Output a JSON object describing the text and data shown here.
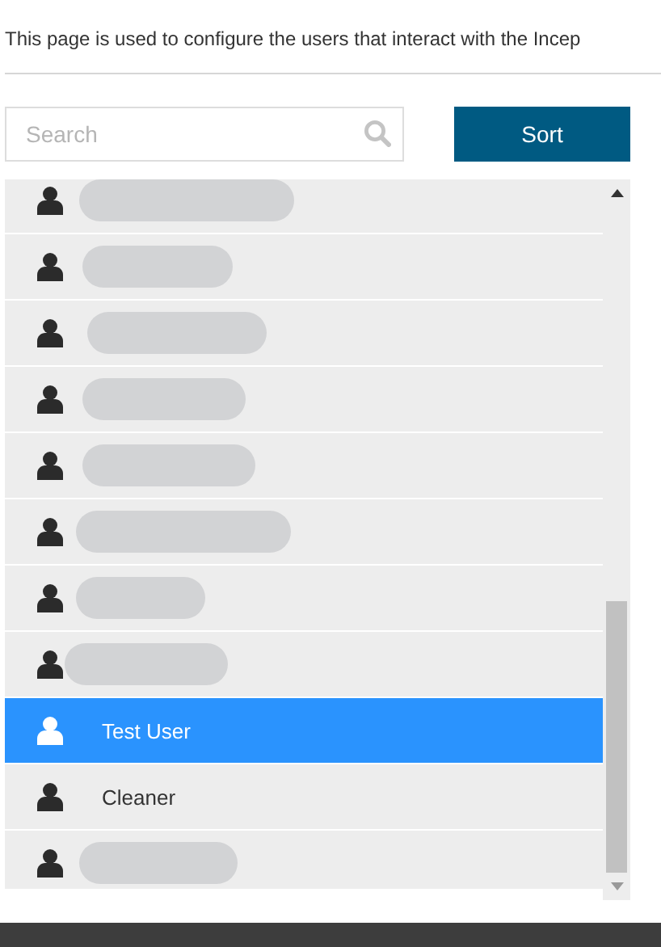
{
  "intro": "This page is used to configure the users that interact with the Incep",
  "search": {
    "placeholder": "Search"
  },
  "sort_button": "Sort",
  "users": [
    {
      "kind": "redacted",
      "selected": false
    },
    {
      "kind": "redacted",
      "selected": false
    },
    {
      "kind": "redacted",
      "selected": false
    },
    {
      "kind": "redacted",
      "selected": false
    },
    {
      "kind": "redacted",
      "selected": false
    },
    {
      "kind": "redacted",
      "selected": false
    },
    {
      "kind": "redacted",
      "selected": false
    },
    {
      "kind": "redacted",
      "selected": false
    },
    {
      "kind": "named",
      "name": "Test User",
      "selected": true
    },
    {
      "kind": "named",
      "name": "Cleaner",
      "selected": false
    },
    {
      "kind": "redacted",
      "selected": false
    }
  ]
}
